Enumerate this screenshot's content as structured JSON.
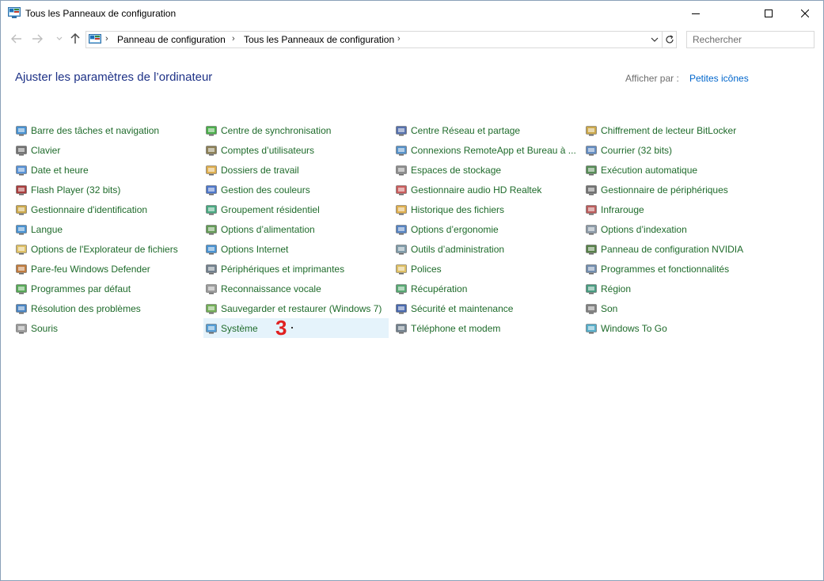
{
  "window": {
    "title": "Tous les Panneaux de configuration"
  },
  "navigation": {
    "breadcrumbs": [
      "Panneau de configuration",
      "Tous les Panneaux de configuration"
    ],
    "search_placeholder": "Rechercher"
  },
  "header": {
    "title": "Ajuster les paramètres de l’ordinateur",
    "view_by_label": "Afficher par :",
    "view_by_value": "Petites icônes"
  },
  "annotation": {
    "step": "3"
  },
  "colors": {
    "link_green": "#1f6b2b",
    "heading_blue": "#1e3287",
    "link_blue": "#0066cc",
    "selection": "#e5f3fb",
    "marker_red": "#e02020"
  },
  "columns": [
    {
      "items": [
        {
          "label": "Barre des tâches et navigation",
          "icon": "taskbar-icon"
        },
        {
          "label": "Clavier",
          "icon": "keyboard-icon"
        },
        {
          "label": "Date et heure",
          "icon": "clock-icon"
        },
        {
          "label": "Flash Player (32 bits)",
          "icon": "flash-icon"
        },
        {
          "label": "Gestionnaire d'identification",
          "icon": "credential-icon"
        },
        {
          "label": "Langue",
          "icon": "language-icon"
        },
        {
          "label": "Options de l'Explorateur de fichiers",
          "icon": "folder-options-icon"
        },
        {
          "label": "Pare-feu Windows Defender",
          "icon": "firewall-icon"
        },
        {
          "label": "Programmes par défaut",
          "icon": "default-programs-icon"
        },
        {
          "label": "Résolution des problèmes",
          "icon": "troubleshoot-icon"
        },
        {
          "label": "Souris",
          "icon": "mouse-icon"
        }
      ]
    },
    {
      "items": [
        {
          "label": "Centre de synchronisation",
          "icon": "sync-icon"
        },
        {
          "label": "Comptes d’utilisateurs",
          "icon": "users-icon"
        },
        {
          "label": "Dossiers de travail",
          "icon": "work-folders-icon"
        },
        {
          "label": "Gestion des couleurs",
          "icon": "color-management-icon"
        },
        {
          "label": "Groupement résidentiel",
          "icon": "homegroup-icon"
        },
        {
          "label": "Options d’alimentation",
          "icon": "power-icon"
        },
        {
          "label": "Options Internet",
          "icon": "internet-options-icon"
        },
        {
          "label": "Périphériques et imprimantes",
          "icon": "printer-icon"
        },
        {
          "label": "Reconnaissance vocale",
          "icon": "microphone-icon"
        },
        {
          "label": "Sauvegarder et restaurer (Windows 7)",
          "icon": "backup-icon"
        },
        {
          "label": "Système",
          "icon": "system-icon",
          "selected": true
        }
      ]
    },
    {
      "items": [
        {
          "label": "Centre Réseau et partage",
          "icon": "network-icon"
        },
        {
          "label": "Connexions RemoteApp et Bureau à ...",
          "icon": "remoteapp-icon"
        },
        {
          "label": "Espaces de stockage",
          "icon": "storage-icon"
        },
        {
          "label": "Gestionnaire audio HD Realtek",
          "icon": "realtek-audio-icon"
        },
        {
          "label": "Historique des fichiers",
          "icon": "file-history-icon"
        },
        {
          "label": "Options d’ergonomie",
          "icon": "ease-of-access-icon"
        },
        {
          "label": "Outils d’administration",
          "icon": "admin-tools-icon"
        },
        {
          "label": "Polices",
          "icon": "fonts-icon"
        },
        {
          "label": "Récupération",
          "icon": "recovery-icon"
        },
        {
          "label": "Sécurité et maintenance",
          "icon": "flag-icon"
        },
        {
          "label": "Téléphone et modem",
          "icon": "phone-icon"
        }
      ]
    },
    {
      "items": [
        {
          "label": "Chiffrement de lecteur BitLocker",
          "icon": "bitlocker-icon"
        },
        {
          "label": "Courrier (32 bits)",
          "icon": "mail-icon"
        },
        {
          "label": "Exécution automatique",
          "icon": "autoplay-icon"
        },
        {
          "label": "Gestionnaire de périphériques",
          "icon": "device-manager-icon"
        },
        {
          "label": "Infrarouge",
          "icon": "infrared-icon"
        },
        {
          "label": "Options d’indexation",
          "icon": "indexing-icon"
        },
        {
          "label": "Panneau de configuration NVIDIA",
          "icon": "nvidia-icon"
        },
        {
          "label": "Programmes et fonctionnalités",
          "icon": "programs-icon"
        },
        {
          "label": "Région",
          "icon": "region-icon"
        },
        {
          "label": "Son",
          "icon": "speaker-icon"
        },
        {
          "label": "Windows To Go",
          "icon": "windows-to-go-icon"
        }
      ]
    }
  ]
}
